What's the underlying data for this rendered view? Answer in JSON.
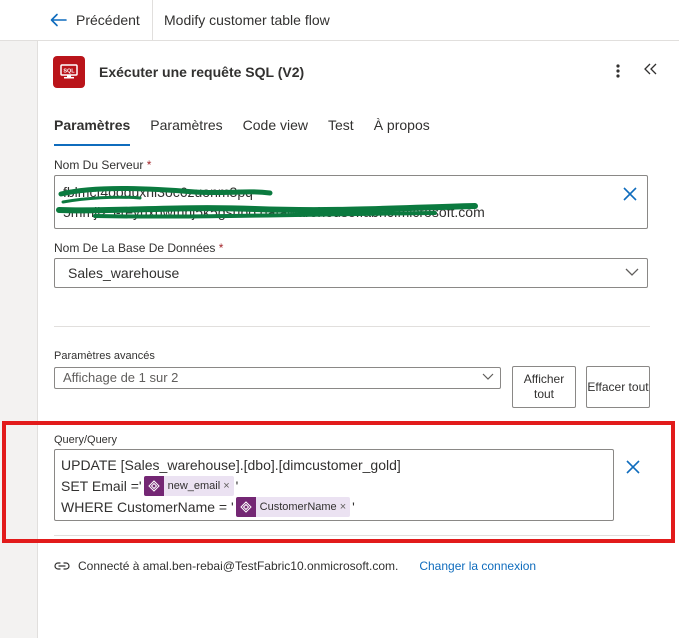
{
  "topbar": {
    "back_label": "Précédent",
    "flow_title": "Modify customer table flow"
  },
  "action": {
    "title": "Exécuter une requête SQL (V2)",
    "icon": "sql-server-icon",
    "brand_color": "#ba141a"
  },
  "tabs": [
    "Paramètres",
    "Paramètres",
    "Code view",
    "Test",
    "À propos"
  ],
  "active_tab_index": 0,
  "server": {
    "label": "Nom Du Serveur",
    "required_mark": "*",
    "value_line1": "fblmcf4ooduxni3oc6zuonm3pq-",
    "value_line2": "5mmji25-reyuxbwtnhj5k5gsubo.datawarehouse.fabric.microsoft.com",
    "redaction_color": "#0b7a3f"
  },
  "database": {
    "label": "Nom De La Base De Données",
    "required_mark": "*",
    "value": "Sales_warehouse"
  },
  "advanced": {
    "label": "Paramètres avancés",
    "select_value": "Affichage de 1 sur 2",
    "show_all_label": "Afficher tout",
    "clear_all_label": "Effacer tout"
  },
  "query": {
    "label": "Query/Query",
    "line1": "UPDATE [Sales_warehouse].[dbo].[dimcustomer_gold]",
    "line2_prefix": "SET Email ='",
    "line2_suffix": "'",
    "token1": "new_email",
    "line3_prefix": "WHERE CustomerName = '",
    "line3_suffix": "'",
    "token2": "CustomerName",
    "token_remove": "×",
    "token_color": "#742774"
  },
  "connection": {
    "text": "Connecté à amal.ben-rebai@TestFabric10.onmicrosoft.com.",
    "change_label": "Changer la connexion"
  },
  "colors": {
    "accent": "#0f6cbd",
    "annotation_frame": "#e21b1b"
  }
}
